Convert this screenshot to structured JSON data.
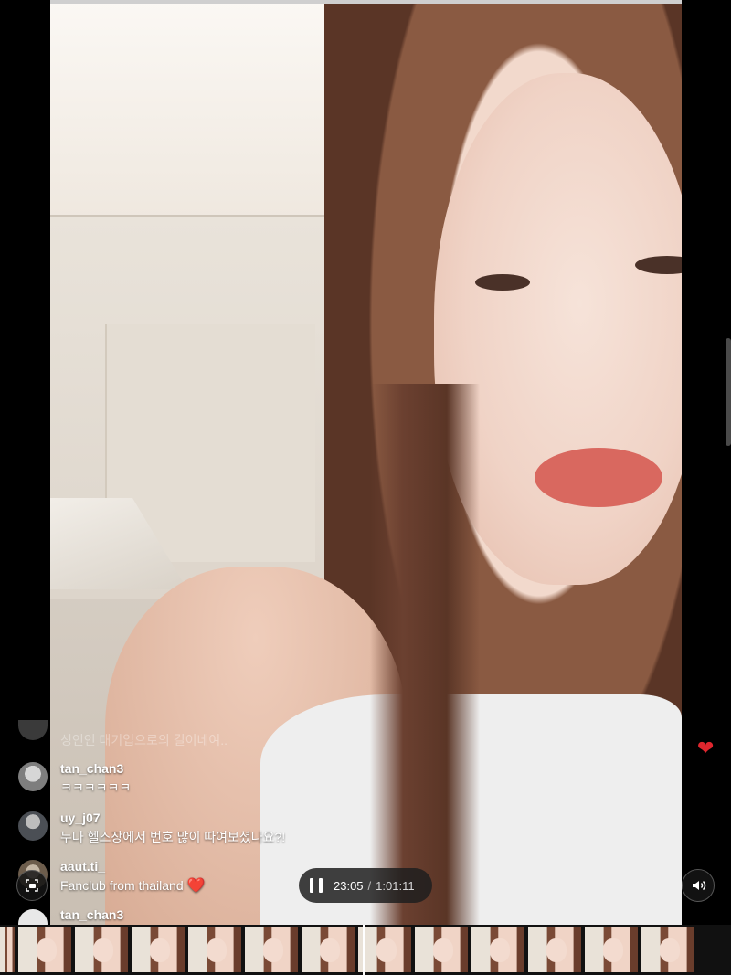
{
  "comments": [
    {
      "username": "",
      "message": "성인인 대기업으로의 길이네여..",
      "faded": true
    },
    {
      "username": "tan_chan3",
      "message": "ㅋㅋㅋㅋㅋㅋ"
    },
    {
      "username": "uy_j07",
      "message": "누나 헬스장에서 번호 많이 따여보셨나요?!"
    },
    {
      "username": "aaut.ti_",
      "message": "Fanclub from thailand",
      "emoji": "❤️"
    },
    {
      "username": "tan_chan3",
      "message": ""
    }
  ],
  "player": {
    "state": "playing",
    "current_time": "23:05",
    "separator": "/",
    "total_time": "1:01:11",
    "progress": 0.377
  },
  "icons": {
    "pause": "pause-icon",
    "volume": "volume-icon",
    "pip": "picture-in-picture-icon",
    "heart": "heart-icon"
  },
  "float_heart": "❤",
  "colors": {
    "accent_heart": "#e0262e",
    "background": "#000000"
  },
  "filmstrip_frame_count": 13
}
